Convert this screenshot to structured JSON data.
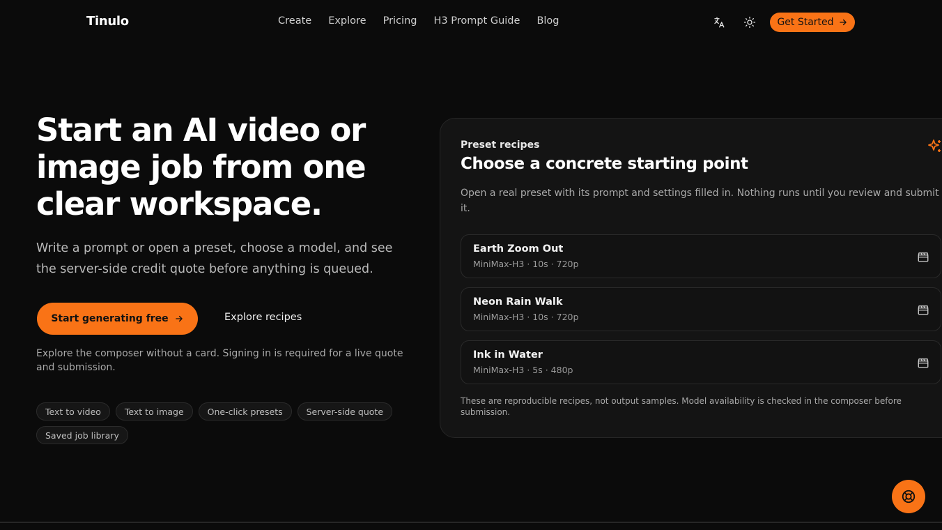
{
  "brand": {
    "name": "Tinulo",
    "accent": "#f97316"
  },
  "nav": {
    "links": [
      "Create",
      "Explore",
      "Pricing",
      "H3 Prompt Guide",
      "Blog"
    ],
    "language_icon": "translate-icon",
    "theme_icon": "sun-icon",
    "cta": "Get Started"
  },
  "hero": {
    "title": "Start an AI video or image job from one clear workspace.",
    "subtitle": "Write a prompt or open a preset, choose a model, and see the server-side credit quote before anything is queued.",
    "primary_cta": "Start generating free",
    "secondary_cta": "Explore recipes",
    "note": "Explore the composer without a card. Signing in is required for a live quote and submission.",
    "chips": [
      "Text to video",
      "Text to image",
      "One-click presets",
      "Server-side quote",
      "Saved job library"
    ]
  },
  "panel": {
    "eyebrow": "Preset recipes",
    "title": "Choose a concrete starting point",
    "description": "Open a real preset with its prompt and settings filled in. Nothing runs until you review and submit it.",
    "recipes": [
      {
        "name": "Earth Zoom Out",
        "meta": "MiniMax-H3 · 10s · 720p"
      },
      {
        "name": "Neon Rain Walk",
        "meta": "MiniMax-H3 · 10s · 720p"
      },
      {
        "name": "Ink in Water",
        "meta": "MiniMax-H3 · 5s · 480p"
      }
    ],
    "footnote": "These are reproducible recipes, not output samples. Model availability is checked in the composer before submission."
  },
  "help_icon": "lifebuoy-icon"
}
